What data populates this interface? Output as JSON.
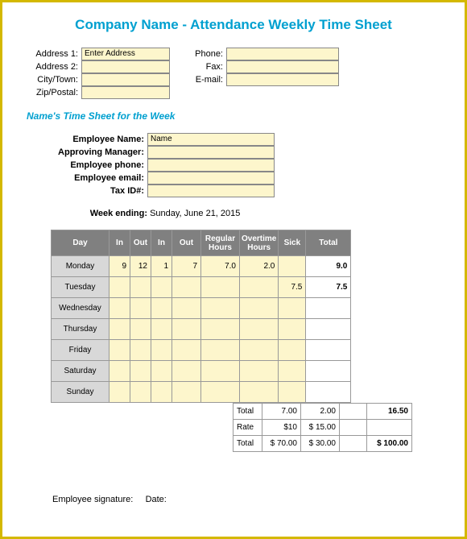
{
  "title": "Company Name - Attendance Weekly Time Sheet",
  "company": {
    "labels": {
      "address1": "Address 1:",
      "address2": "Address 2:",
      "city": "City/Town:",
      "zip": "Zip/Postal:",
      "phone": "Phone:",
      "fax": "Fax:",
      "email": "E-mail:"
    },
    "values": {
      "address1": "Enter Address",
      "address2": "",
      "city": "",
      "zip": "",
      "phone": "",
      "fax": "",
      "email": ""
    }
  },
  "subhead": "Name's Time Sheet for the Week",
  "employee": {
    "labels": {
      "name": "Employee Name:",
      "manager": "Approving Manager:",
      "phone": "Employee phone:",
      "email": "Employee email:",
      "taxid": "Tax ID#:"
    },
    "values": {
      "name": "Name",
      "manager": "",
      "phone": "",
      "email": "",
      "taxid": ""
    }
  },
  "week_ending": {
    "label": "Week ending:",
    "value": "Sunday, June 21, 2015"
  },
  "headers": {
    "day": "Day",
    "in1": "In",
    "out1": "Out",
    "in2": "In",
    "out2": "Out",
    "regular": "Regular Hours",
    "overtime": "Overtime Hours",
    "sick": "Sick",
    "total": "Total"
  },
  "rows": [
    {
      "day": "Monday",
      "in1": "9",
      "out1": "12",
      "in2": "1",
      "out2": "7",
      "regular": "7.0",
      "overtime": "2.0",
      "sick": "",
      "total": "9.0"
    },
    {
      "day": "Tuesday",
      "in1": "",
      "out1": "",
      "in2": "",
      "out2": "",
      "regular": "",
      "overtime": "",
      "sick": "7.5",
      "total": "7.5"
    },
    {
      "day": "Wednesday",
      "in1": "",
      "out1": "",
      "in2": "",
      "out2": "",
      "regular": "",
      "overtime": "",
      "sick": "",
      "total": ""
    },
    {
      "day": "Thursday",
      "in1": "",
      "out1": "",
      "in2": "",
      "out2": "",
      "regular": "",
      "overtime": "",
      "sick": "",
      "total": ""
    },
    {
      "day": "Friday",
      "in1": "",
      "out1": "",
      "in2": "",
      "out2": "",
      "regular": "",
      "overtime": "",
      "sick": "",
      "total": ""
    },
    {
      "day": "Saturday",
      "in1": "",
      "out1": "",
      "in2": "",
      "out2": "",
      "regular": "",
      "overtime": "",
      "sick": "",
      "total": ""
    },
    {
      "day": "Sunday",
      "in1": "",
      "out1": "",
      "in2": "",
      "out2": "",
      "regular": "",
      "overtime": "",
      "sick": "",
      "total": ""
    }
  ],
  "summary": {
    "total_label": "Total",
    "total_regular": "7.00",
    "total_overtime": "2.00",
    "total_total": "16.50",
    "rate_label": "Rate",
    "rate_regular": "$10",
    "rate_overtime": "$   15.00",
    "pay_label": "Total",
    "pay_regular": "$   70.00",
    "pay_overtime": "$   30.00",
    "pay_total": "$   100.00"
  },
  "signature": {
    "emp": "Employee signature:",
    "date": "Date:"
  },
  "chart_data": {
    "type": "table",
    "title": "Attendance Weekly Time Sheet",
    "columns": [
      "Day",
      "In",
      "Out",
      "In",
      "Out",
      "Regular Hours",
      "Overtime Hours",
      "Sick",
      "Total"
    ],
    "data": [
      [
        "Monday",
        9,
        12,
        1,
        7,
        7.0,
        2.0,
        null,
        9.0
      ],
      [
        "Tuesday",
        null,
        null,
        null,
        null,
        null,
        null,
        7.5,
        7.5
      ],
      [
        "Wednesday",
        null,
        null,
        null,
        null,
        null,
        null,
        null,
        null
      ],
      [
        "Thursday",
        null,
        null,
        null,
        null,
        null,
        null,
        null,
        null
      ],
      [
        "Friday",
        null,
        null,
        null,
        null,
        null,
        null,
        null,
        null
      ],
      [
        "Saturday",
        null,
        null,
        null,
        null,
        null,
        null,
        null,
        null
      ],
      [
        "Sunday",
        null,
        null,
        null,
        null,
        null,
        null,
        null,
        null
      ]
    ],
    "totals": {
      "regular_hours": 7.0,
      "overtime_hours": 2.0,
      "grand_total": 16.5,
      "rate_regular": 10,
      "rate_overtime": 15,
      "pay_regular": 70.0,
      "pay_overtime": 30.0,
      "pay_total": 100.0
    }
  }
}
